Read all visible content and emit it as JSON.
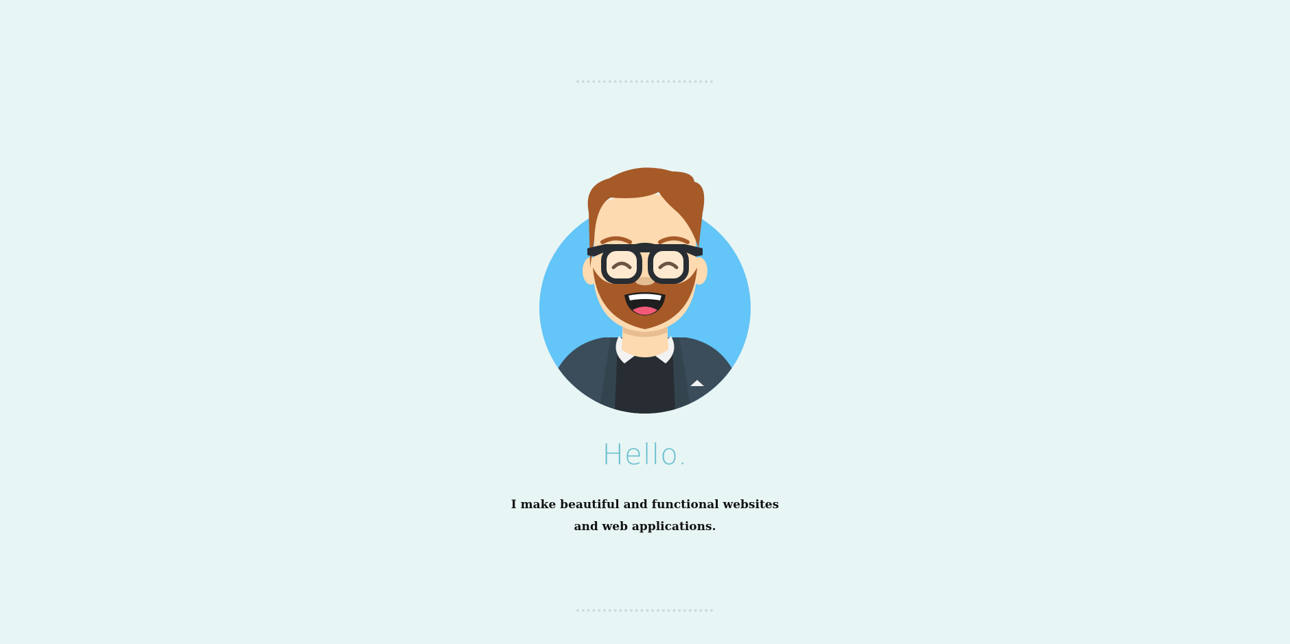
{
  "hero": {
    "greeting": "Hello.",
    "tagline": "I make beautiful and functional websites and web applications."
  },
  "icons": {
    "avatar": "bearded-man-with-glasses-avatar",
    "divider": "dotted-divider"
  },
  "colors": {
    "background": "#e8f5f5",
    "greeting": "#69bfd0",
    "avatar_circle": "#63c5f8",
    "hair": "#a65a28",
    "skin": "#fddab0",
    "jacket": "#3b4d5b",
    "shirt": "#272d33",
    "divider_dot": "#c5d8dc"
  }
}
